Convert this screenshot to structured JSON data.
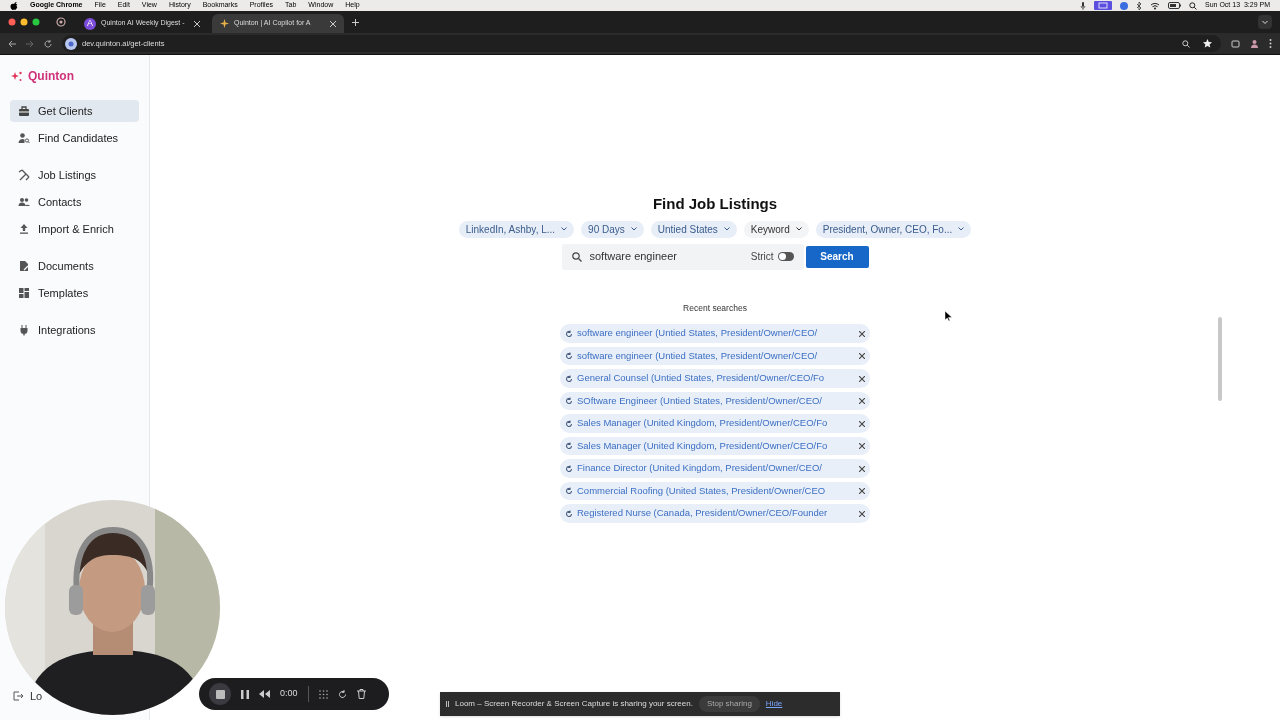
{
  "menu_bar": {
    "app": "Google Chrome",
    "items": [
      "File",
      "Edit",
      "View",
      "History",
      "Bookmarks",
      "Profiles",
      "Tab",
      "Window",
      "Help"
    ],
    "clock": "Sun Oct 13  3:29 PM"
  },
  "browser": {
    "tabs": [
      {
        "title": "Quinton AI Weekly Digest -",
        "selected": false,
        "favicon": "A"
      },
      {
        "title": "Quinton | AI Copilot for A",
        "selected": true
      }
    ],
    "url": "dev.quinton.ai/get-clients"
  },
  "sidebar": {
    "logo": "Quinton",
    "groups": [
      [
        {
          "label": "Get Clients",
          "selected": true
        },
        {
          "label": "Find Candidates",
          "selected": false
        }
      ],
      [
        {
          "label": "Job Listings",
          "selected": false
        },
        {
          "label": "Contacts",
          "selected": false
        },
        {
          "label": "Import & Enrich",
          "selected": false
        }
      ],
      [
        {
          "label": "Documents",
          "selected": false
        },
        {
          "label": "Templates",
          "selected": false
        }
      ],
      [
        {
          "label": "Integrations",
          "selected": false
        }
      ]
    ],
    "logout": "Lo"
  },
  "main": {
    "title": "Find Job Listings",
    "filters": [
      {
        "label": "LinkedIn, Ashby, L...",
        "active": true
      },
      {
        "label": "90 Days",
        "active": true
      },
      {
        "label": "Untied States",
        "active": true
      },
      {
        "label": "Keyword",
        "active": false
      },
      {
        "label": "President, Owner, CEO, Fo...",
        "active": true
      }
    ],
    "search": {
      "value": "software engineer",
      "strict_label": "Strict",
      "strict_on": false,
      "button": "Search"
    },
    "recent_title": "Recent searches",
    "recent": [
      "software engineer (Untied States, President/Owner/CEO/",
      "software engineer (Untied States, President/Owner/CEO/",
      "General Counsel (Untied States, President/Owner/CEO/Fo",
      "SOftware Engineer (Untied States, President/Owner/CEO/",
      "Sales Manager (United Kingdom, President/Owner/CEO/Fo",
      "Sales Manager (United Kingdom, President/Owner/CEO/Fo",
      "Finance Director (United Kingdom, President/Owner/CEO/",
      "Commercial Roofing (United States, President/Owner/CEO",
      "Registered Nurse (Canada, President/Owner/CEO/Founder"
    ]
  },
  "recorder": {
    "time": "0:00"
  },
  "share_notice": {
    "text": "Loom – Screen Recorder & Screen Capture is sharing your screen.",
    "stop": "Stop sharing",
    "hide": "Hide"
  }
}
